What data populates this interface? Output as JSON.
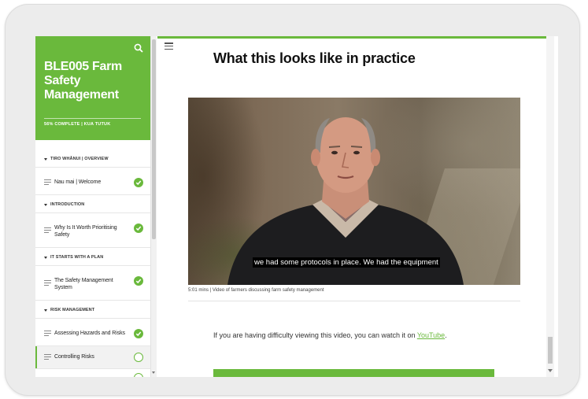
{
  "course": {
    "title": "BLE005 Farm Safety Management",
    "progress": "56% COMPLETE | KUA TUTUK"
  },
  "sidebar": {
    "sections": [
      {
        "label": "TIRO WHĀNUI | OVERVIEW"
      },
      {
        "label": "INTRODUCTION"
      },
      {
        "label": "IT STARTS WITH A PLAN"
      },
      {
        "label": "RISK MANAGEMENT"
      }
    ],
    "lessons": [
      {
        "label": "Nau mai | Welcome",
        "status": "complete"
      },
      {
        "label": "Why Is It Worth Prioritising Safety",
        "status": "complete"
      },
      {
        "label": "The Safety Management System",
        "status": "complete"
      },
      {
        "label": "Assessing Hazards and Risks",
        "status": "complete"
      },
      {
        "label": "Controlling Risks",
        "status": "in-progress"
      }
    ]
  },
  "main": {
    "heading": "What this looks like in practice",
    "video": {
      "caption": "we had some protocols in place. We had the equipment",
      "meta": "5:01 mins | Video of farmers discussing farm safety management"
    },
    "help_text": "If you are having difficulty viewing this video, you can watch it on ",
    "help_link": "YouTube",
    "help_end": "."
  },
  "colors": {
    "accent": "#6ab93c",
    "text": "#111111"
  },
  "icons": {
    "search": "search-icon",
    "menu": "hamburger-menu-icon",
    "complete": "check-circle-icon",
    "in_progress": "empty-circle-icon",
    "lesson": "lesson-lines-icon",
    "section_toggle": "triangle-down-icon"
  }
}
